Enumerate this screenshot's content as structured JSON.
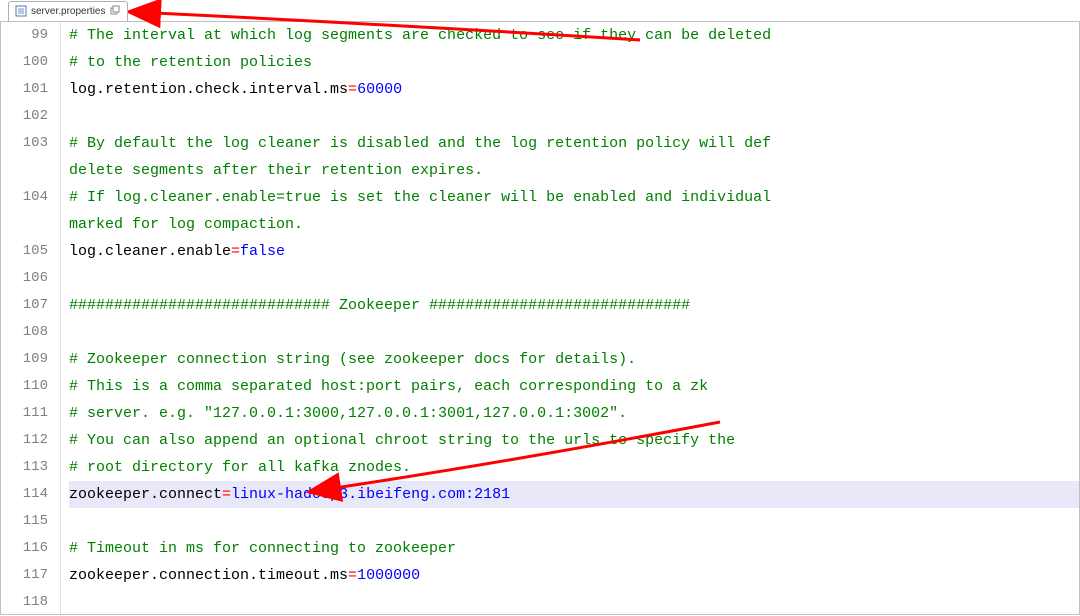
{
  "tab": {
    "filename": "server.properties",
    "icon": "file-icon"
  },
  "lines": [
    {
      "num": 99,
      "type": "comment",
      "text": "# The interval at which log segments are checked to see if they can be deleted"
    },
    {
      "num": 100,
      "type": "comment",
      "text": "# to the retention policies"
    },
    {
      "num": 101,
      "type": "kv",
      "key": "log.retention.check.interval.ms",
      "value": "60000"
    },
    {
      "num": 102,
      "type": "blank",
      "text": ""
    },
    {
      "num": 103,
      "type": "comment-wrap",
      "text1": "# By default the log cleaner is disabled and the log retention policy will def",
      "text2": "delete segments after their retention expires."
    },
    {
      "num": 104,
      "type": "comment-wrap",
      "text1": "# If log.cleaner.enable=true is set the cleaner will be enabled and individual",
      "text2": "marked for log compaction."
    },
    {
      "num": 105,
      "type": "kv",
      "key": "log.cleaner.enable",
      "value": "false"
    },
    {
      "num": 106,
      "type": "blank",
      "text": ""
    },
    {
      "num": 107,
      "type": "comment",
      "text": "############################# Zookeeper #############################"
    },
    {
      "num": 108,
      "type": "blank",
      "text": ""
    },
    {
      "num": 109,
      "type": "comment",
      "text": "# Zookeeper connection string (see zookeeper docs for details)."
    },
    {
      "num": 110,
      "type": "comment",
      "text": "# This is a comma separated host:port pairs, each corresponding to a zk"
    },
    {
      "num": 111,
      "type": "comment",
      "text": "# server. e.g. \"127.0.0.1:3000,127.0.0.1:3001,127.0.0.1:3002\"."
    },
    {
      "num": 112,
      "type": "comment",
      "text": "# You can also append an optional chroot string to the urls to specify the"
    },
    {
      "num": 113,
      "type": "comment",
      "text": "# root directory for all kafka znodes."
    },
    {
      "num": 114,
      "type": "kv",
      "key": "zookeeper.connect",
      "value": "linux-hadoop3.ibeifeng.com:2181",
      "highlight": true
    },
    {
      "num": 115,
      "type": "blank",
      "text": ""
    },
    {
      "num": 116,
      "type": "comment",
      "text": "# Timeout in ms for connecting to zookeeper"
    },
    {
      "num": 117,
      "type": "kv",
      "key": "zookeeper.connection.timeout.ms",
      "value": "1000000"
    },
    {
      "num": 118,
      "type": "blank",
      "text": ""
    }
  ],
  "arrows": {
    "color": "#ff0000"
  }
}
